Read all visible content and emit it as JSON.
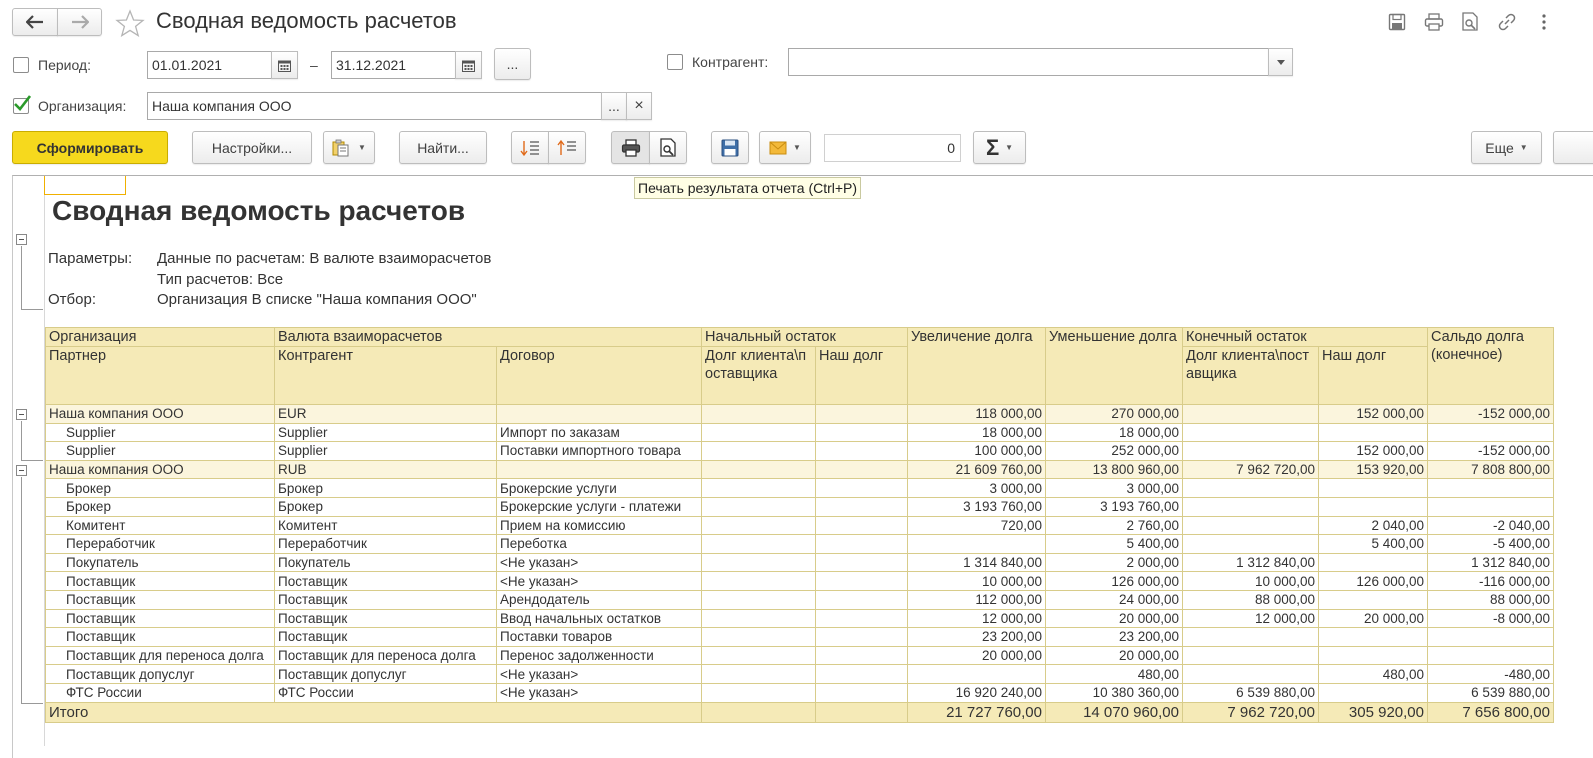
{
  "title": "Сводная ведомость расчетов",
  "filters": {
    "period_label": "Период:",
    "date_from": "01.01.2021",
    "dash": "–",
    "date_to": "31.12.2021",
    "more_label": "...",
    "counterparty_label": "Контрагент:",
    "counterparty_value": "",
    "org_label": "Организация:",
    "org_value": "Наша компания ООО",
    "org_pick": "...",
    "org_clear": "×"
  },
  "toolbar": {
    "generate": "Сформировать",
    "settings": "Настройки...",
    "find": "Найти...",
    "counter_value": "0",
    "more": "Еще"
  },
  "tooltip": "Печать результата отчета (Ctrl+P)",
  "report": {
    "title": "Сводная ведомость расчетов",
    "params_label": "Параметры:",
    "param1": "Данные по расчетам: В валюте взаиморасчетов",
    "param2": "Тип расчетов: Все",
    "filter_label": "Отбор:",
    "filter_value": "Организация В списке \"Наша компания ООО\""
  },
  "headers": {
    "org": "Организация",
    "currency": "Валюта взаиморасчетов",
    "opening": "Начальный остаток",
    "increase": "Увеличение долга",
    "decrease": "Уменьшение долга",
    "closing": "Конечный остаток",
    "balance": "Сальдо долга (конечное)",
    "partner": "Партнер",
    "counterparty": "Контрагент",
    "contract": "Договор",
    "client_debt_open": "Долг клиента\\поставщика",
    "our_debt_open": "Наш долг",
    "client_debt_close": "Долг клиента\\поставщика",
    "our_debt_close": "Наш долг"
  },
  "rows": [
    {
      "g": 1,
      "a": "Наша компания ООО",
      "b": "EUR",
      "c": "",
      "d": "",
      "e": "",
      "f": "118 000,00",
      "h": "270 000,00",
      "i": "",
      "j": "152 000,00",
      "k": "-152 000,00",
      "neg": true
    },
    {
      "g": 0,
      "a": "Supplier",
      "b": "Supplier",
      "c": "Импорт по заказам",
      "d": "",
      "e": "",
      "f": "18 000,00",
      "h": "18 000,00",
      "i": "",
      "j": "",
      "k": ""
    },
    {
      "g": 0,
      "a": "Supplier",
      "b": "Supplier",
      "c": "Поставки импортного товара",
      "d": "",
      "e": "",
      "f": "100 000,00",
      "h": "252 000,00",
      "i": "",
      "j": "152 000,00",
      "k": "-152 000,00",
      "neg": true
    },
    {
      "g": 1,
      "a": "Наша компания ООО",
      "b": "RUB",
      "c": "",
      "d": "",
      "e": "",
      "f": "21 609 760,00",
      "h": "13 800 960,00",
      "i": "7 962 720,00",
      "j": "153 920,00",
      "k": "7 808 800,00"
    },
    {
      "g": 0,
      "a": "Брокер",
      "b": "Брокер",
      "c": "Брокерские услуги",
      "d": "",
      "e": "",
      "f": "3 000,00",
      "h": "3 000,00",
      "i": "",
      "j": "",
      "k": ""
    },
    {
      "g": 0,
      "a": "Брокер",
      "b": "Брокер",
      "c": "Брокерские услуги - платежи",
      "d": "",
      "e": "",
      "f": "3 193 760,00",
      "h": "3 193 760,00",
      "i": "",
      "j": "",
      "k": ""
    },
    {
      "g": 0,
      "a": "Комитент",
      "b": "Комитент",
      "c": "Прием на комиссию",
      "d": "",
      "e": "",
      "f": "720,00",
      "h": "2 760,00",
      "i": "",
      "j": "2 040,00",
      "k": "-2 040,00",
      "neg": true
    },
    {
      "g": 0,
      "a": "Переработчик",
      "b": "Переработчик",
      "c": "Переботка",
      "d": "",
      "e": "",
      "f": "",
      "h": "5 400,00",
      "i": "",
      "j": "5 400,00",
      "k": "-5 400,00",
      "neg": true
    },
    {
      "g": 0,
      "a": "Покупатель",
      "b": "Покупатель",
      "c": "<Не указан>",
      "gray": true,
      "d": "",
      "e": "",
      "f": "1 314 840,00",
      "h": "2 000,00",
      "i": "1 312 840,00",
      "j": "",
      "k": "1 312 840,00"
    },
    {
      "g": 0,
      "a": "Поставщик",
      "b": "Поставщик",
      "c": "<Не указан>",
      "gray": true,
      "d": "",
      "e": "",
      "f": "10 000,00",
      "h": "126 000,00",
      "i": "10 000,00",
      "j": "126 000,00",
      "k": "-116 000,00",
      "neg": true
    },
    {
      "g": 0,
      "a": "Поставщик",
      "b": "Поставщик",
      "c": "Арендодатель",
      "d": "",
      "e": "",
      "f": "112 000,00",
      "h": "24 000,00",
      "i": "88 000,00",
      "j": "",
      "k": "88 000,00"
    },
    {
      "g": 0,
      "a": "Поставщик",
      "b": "Поставщик",
      "c": "Ввод начальных остатков",
      "d": "",
      "e": "",
      "f": "12 000,00",
      "h": "20 000,00",
      "i": "12 000,00",
      "j": "20 000,00",
      "k": "-8 000,00",
      "neg": true
    },
    {
      "g": 0,
      "a": "Поставщик",
      "b": "Поставщик",
      "c": "Поставки товаров",
      "d": "",
      "e": "",
      "f": "23 200,00",
      "h": "23 200,00",
      "i": "",
      "j": "",
      "k": ""
    },
    {
      "g": 0,
      "a": "Поставщик для переноса долга",
      "b": "Поставщик для переноса долга",
      "c": "Перенос задолженности",
      "d": "",
      "e": "",
      "f": "20 000,00",
      "h": "20 000,00",
      "i": "",
      "j": "",
      "k": ""
    },
    {
      "g": 0,
      "a": "Поставщик допуслуг",
      "b": "Поставщик допуслуг",
      "c": "<Не указан>",
      "gray": true,
      "d": "",
      "e": "",
      "f": "",
      "h": "480,00",
      "i": "",
      "j": "480,00",
      "k": "-480,00",
      "neg": true
    },
    {
      "g": 0,
      "a": "ФТС России",
      "b": "ФТС России",
      "c": "<Не указан>",
      "gray": true,
      "d": "",
      "e": "",
      "f": "16 920 240,00",
      "h": "10 380 360,00",
      "i": "6 539 880,00",
      "j": "",
      "k": "6 539 880,00"
    }
  ],
  "total": {
    "label": "Итого",
    "f": "21 727 760,00",
    "h": "14 070 960,00",
    "i": "7 962 720,00",
    "j": "305 920,00",
    "k": "7 656 800,00"
  }
}
